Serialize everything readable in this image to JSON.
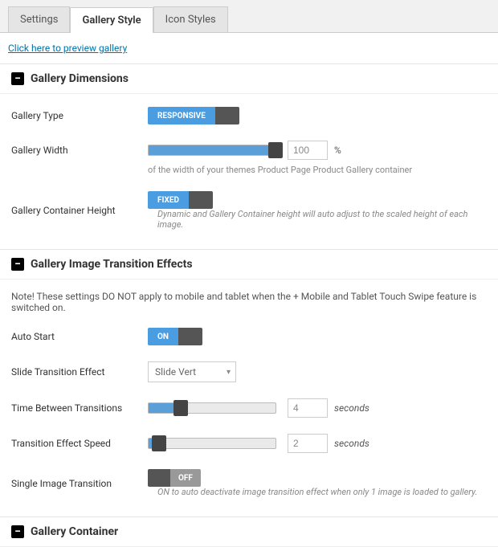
{
  "tabs": {
    "settings": "Settings",
    "gallery_style": "Gallery Style",
    "icon_styles": "Icon Styles"
  },
  "preview_link": "Click here to preview gallery",
  "sections": {
    "dimensions": {
      "title": "Gallery Dimensions",
      "gallery_type": {
        "label": "Gallery Type",
        "value": "RESPONSIVE"
      },
      "gallery_width": {
        "label": "Gallery Width",
        "value": "100",
        "unit": "%",
        "helper": "of the width of your themes Product Page Product Gallery container"
      },
      "container_height": {
        "label": "Gallery Container Height",
        "value": "FIXED",
        "helper": "Dynamic and Gallery Container height will auto adjust to the scaled height of each image."
      }
    },
    "transitions": {
      "title": "Gallery Image Transition Effects",
      "note": "Note! These settings DO NOT apply to mobile and tablet when the + Mobile and Tablet Touch Swipe feature is switched on.",
      "auto_start": {
        "label": "Auto Start",
        "value": "ON"
      },
      "slide_effect": {
        "label": "Slide Transition Effect",
        "value": "Slide Vert"
      },
      "time_between": {
        "label": "Time Between Transitions",
        "value": "4",
        "unit": "seconds"
      },
      "speed": {
        "label": "Transition Effect Speed",
        "value": "2",
        "unit": "seconds"
      },
      "single_image": {
        "label": "Single Image Transition",
        "value": "OFF",
        "helper": "ON to auto deactivate image transition effect when only 1 image is loaded to gallery."
      }
    },
    "container": {
      "title": "Gallery Container"
    }
  },
  "chart_data": {
    "type": "table",
    "sliders": [
      {
        "name": "Gallery Width",
        "percent": 100
      },
      {
        "name": "Time Between Transitions",
        "percent": 25
      },
      {
        "name": "Transition Effect Speed",
        "percent": 8
      }
    ]
  }
}
